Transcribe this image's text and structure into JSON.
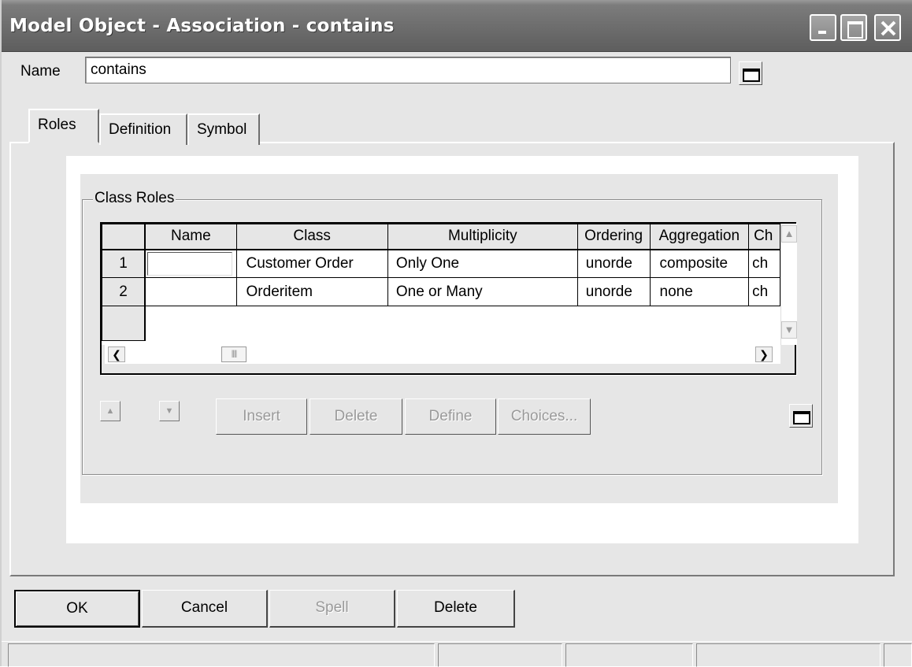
{
  "window": {
    "title": "Model Object - Association - contains"
  },
  "name_field": {
    "label": "Name",
    "value": "contains"
  },
  "tabs": [
    {
      "label": "Roles",
      "active": true
    },
    {
      "label": "Definition",
      "active": false
    },
    {
      "label": "Symbol",
      "active": false
    }
  ],
  "class_roles": {
    "title": "Class Roles",
    "columns": [
      "Name",
      "Class",
      "Multiplicity",
      "Ordering",
      "Aggregation",
      "Ch"
    ],
    "rows": [
      {
        "num": "1",
        "name": "",
        "class": "Customer Order",
        "multiplicity": "Only One",
        "ordering": "unorde",
        "aggregation": "composite",
        "ch": "ch"
      },
      {
        "num": "2",
        "name": "",
        "class": "Orderitem",
        "multiplicity": "One or Many",
        "ordering": "unorde",
        "aggregation": "none",
        "ch": "ch"
      }
    ]
  },
  "row_actions": {
    "insert": "Insert",
    "delete": "Delete",
    "define": "Define",
    "choices": "Choices..."
  },
  "dialog_buttons": {
    "ok": "OK",
    "cancel": "Cancel",
    "spell": "Spell",
    "delete": "Delete"
  }
}
